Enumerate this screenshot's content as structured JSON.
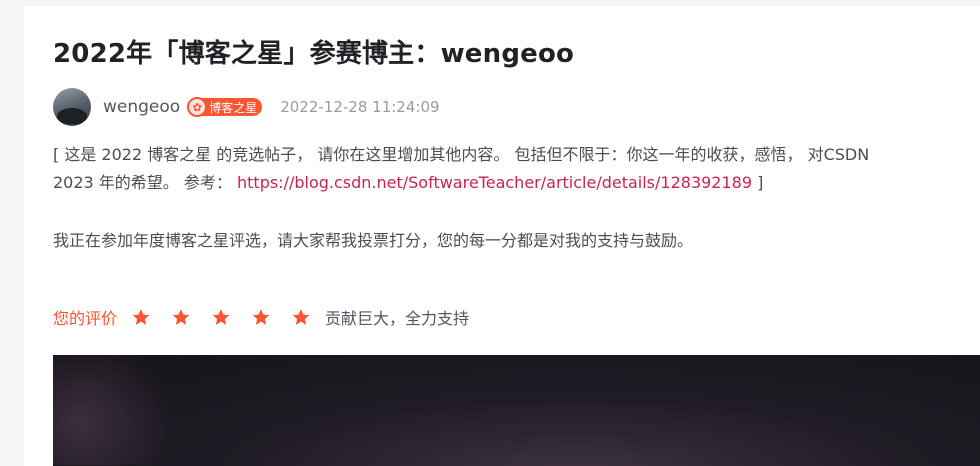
{
  "article": {
    "title": "2022年「博客之星」参赛博主：wengeoo",
    "author": "wengeoo",
    "badge": "博客之星",
    "time": "2022-12-28 11:24:09",
    "para1_line1": "[ 这是 2022 博客之星 的竞选帖子， 请你在这里增加其他内容。 包括但不限于：你这一年的收获，感悟， 对CSDN",
    "para1_line2_prefix": "2023 年的希望。 参考：",
    "link": "https://blog.csdn.net/SoftwareTeacher/article/details/128392189",
    "para1_line2_suffix": " ]",
    "para2": "我正在参加年度博客之星评选，请大家帮我投票打分，您的每一分都是对我的支持与鼓励。"
  },
  "rating": {
    "label": "您的评价",
    "stars": 5,
    "max_stars": 5,
    "text": "贡献巨大，全力支持",
    "color": "#fc5531"
  },
  "icons": [
    "avatar",
    "blog-star-badge-icon",
    "star-icon"
  ]
}
